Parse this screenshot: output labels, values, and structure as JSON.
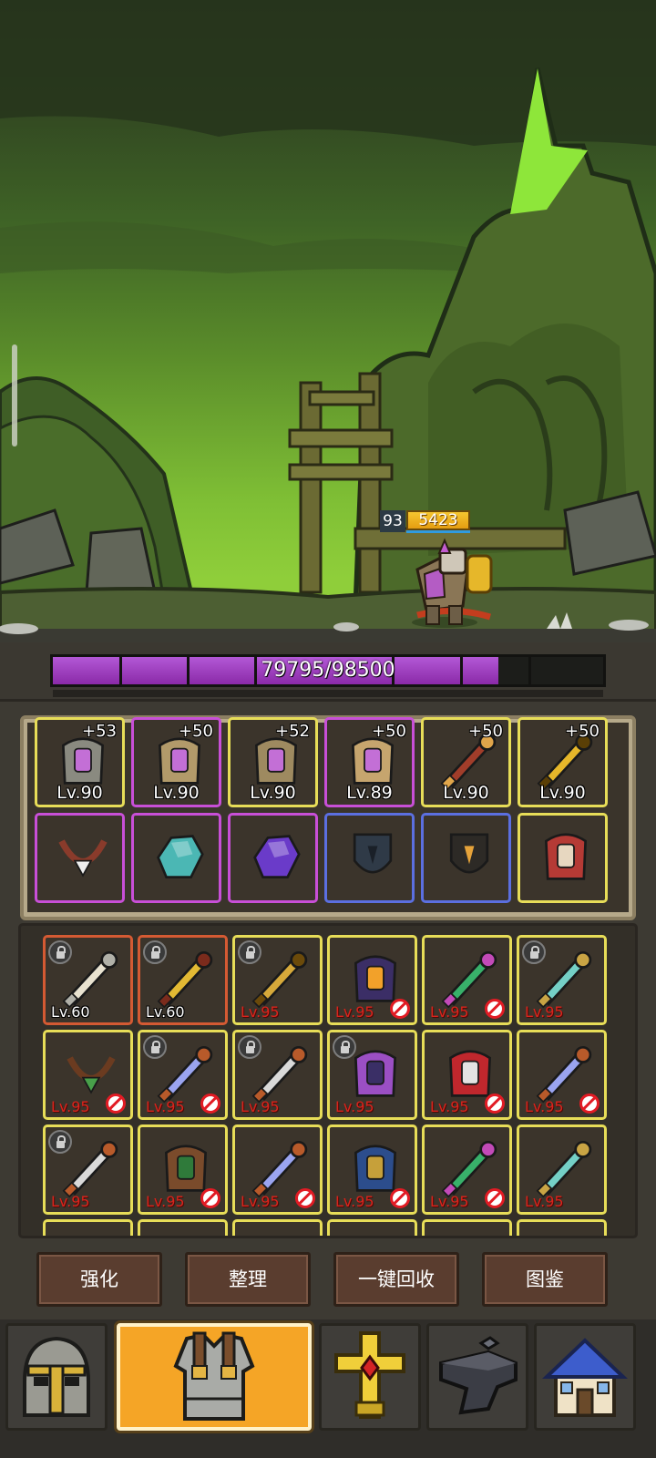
{
  "battle": {
    "player_level": "93",
    "player_power": "5423",
    "boss_hp_text": "79795/98500",
    "boss_hp_fraction": 0.81
  },
  "equipped": [
    {
      "name": "helmet",
      "plus": "+53",
      "level": "Lv.90",
      "rarity": "yellow",
      "icon": "helmet-icon"
    },
    {
      "name": "shoulder",
      "plus": "+50",
      "level": "Lv.90",
      "rarity": "purple",
      "icon": "shoulder-armor-icon"
    },
    {
      "name": "chest",
      "plus": "+52",
      "level": "Lv.90",
      "rarity": "yellow",
      "icon": "chest-armor-icon"
    },
    {
      "name": "legs",
      "plus": "+50",
      "level": "Lv.89",
      "rarity": "purple",
      "icon": "leg-armor-icon"
    },
    {
      "name": "sword",
      "plus": "+50",
      "level": "Lv.90",
      "rarity": "yellow",
      "icon": "sword-icon"
    },
    {
      "name": "hammer",
      "plus": "+50",
      "level": "Lv.90",
      "rarity": "yellow",
      "icon": "hammer-icon"
    }
  ],
  "accessories": [
    {
      "rarity": "purple",
      "icon": "fang-necklace-icon"
    },
    {
      "rarity": "purple",
      "icon": "teal-gem-icon"
    },
    {
      "rarity": "purple",
      "icon": "purple-gem-icon"
    },
    {
      "rarity": "blue",
      "icon": "shield-icon"
    },
    {
      "rarity": "blue",
      "icon": "rune-card-icon"
    },
    {
      "rarity": "yellow",
      "icon": "helm-mask-icon"
    }
  ],
  "bag": [
    {
      "level": "Lv.60",
      "rarity": "red",
      "locked": true,
      "banned": false,
      "icon": "bone-sword-icon",
      "lvcolor": "white"
    },
    {
      "level": "Lv.60",
      "rarity": "red",
      "locked": true,
      "banned": false,
      "icon": "spiked-mace-icon",
      "lvcolor": "white"
    },
    {
      "level": "Lv.95",
      "rarity": "yellow",
      "locked": true,
      "banned": false,
      "icon": "golden-staff-icon",
      "lvcolor": "red"
    },
    {
      "level": "Lv.95",
      "rarity": "yellow",
      "locked": false,
      "banned": true,
      "icon": "flame-hood-icon",
      "lvcolor": "red"
    },
    {
      "level": "Lv.95",
      "rarity": "yellow",
      "locked": false,
      "banned": true,
      "icon": "jade-scepter-icon",
      "lvcolor": "red"
    },
    {
      "level": "Lv.95",
      "rarity": "yellow",
      "locked": true,
      "banned": false,
      "icon": "trident-icon",
      "lvcolor": "red"
    },
    {
      "level": "Lv.95",
      "rarity": "yellow",
      "locked": false,
      "banned": true,
      "icon": "horn-necklace-icon",
      "lvcolor": "red"
    },
    {
      "level": "Lv.95",
      "rarity": "yellow",
      "locked": true,
      "banned": true,
      "icon": "crystal-spear-icon",
      "lvcolor": "red"
    },
    {
      "level": "Lv.95",
      "rarity": "yellow",
      "locked": true,
      "banned": false,
      "icon": "dagger-icon",
      "lvcolor": "red"
    },
    {
      "level": "Lv.95",
      "rarity": "yellow",
      "locked": true,
      "banned": false,
      "icon": "violet-armor-icon",
      "lvcolor": "red"
    },
    {
      "level": "Lv.95",
      "rarity": "yellow",
      "locked": false,
      "banned": true,
      "icon": "crimson-cape-icon",
      "lvcolor": "red"
    },
    {
      "level": "Lv.95",
      "rarity": "yellow",
      "locked": false,
      "banned": true,
      "icon": "crystal-spear-icon",
      "lvcolor": "red"
    },
    {
      "level": "Lv.95",
      "rarity": "yellow",
      "locked": true,
      "banned": false,
      "icon": "dagger-icon",
      "lvcolor": "red"
    },
    {
      "level": "Lv.95",
      "rarity": "yellow",
      "locked": false,
      "banned": true,
      "icon": "chest-box-icon",
      "lvcolor": "red"
    },
    {
      "level": "Lv.95",
      "rarity": "yellow",
      "locked": false,
      "banned": true,
      "icon": "crystal-spear-icon",
      "lvcolor": "red"
    },
    {
      "level": "Lv.95",
      "rarity": "yellow",
      "locked": false,
      "banned": true,
      "icon": "blue-greaves-icon",
      "lvcolor": "red"
    },
    {
      "level": "Lv.95",
      "rarity": "yellow",
      "locked": false,
      "banned": true,
      "icon": "jade-scepter-icon",
      "lvcolor": "red"
    },
    {
      "level": "Lv.95",
      "rarity": "yellow",
      "locked": false,
      "banned": false,
      "icon": "trident-icon",
      "lvcolor": "red"
    }
  ],
  "actions": {
    "enhance": "强化",
    "organize": "整理",
    "recycle_all": "一键回收",
    "codex": "图鉴"
  },
  "nav": [
    {
      "icon": "knight-helmet-icon",
      "active": false
    },
    {
      "icon": "armor-vest-icon",
      "active": true
    },
    {
      "icon": "holy-cross-icon",
      "active": false
    },
    {
      "icon": "anvil-icon",
      "active": false
    },
    {
      "icon": "house-icon",
      "active": false
    }
  ],
  "colors": {
    "rarity_yellow": "#e7dd58",
    "rarity_purple": "#c84fd7",
    "rarity_blue": "#5b6fe0",
    "rarity_red": "#d45a33",
    "hp_bar": "#a344c6",
    "active_tab": "#f5a526"
  }
}
